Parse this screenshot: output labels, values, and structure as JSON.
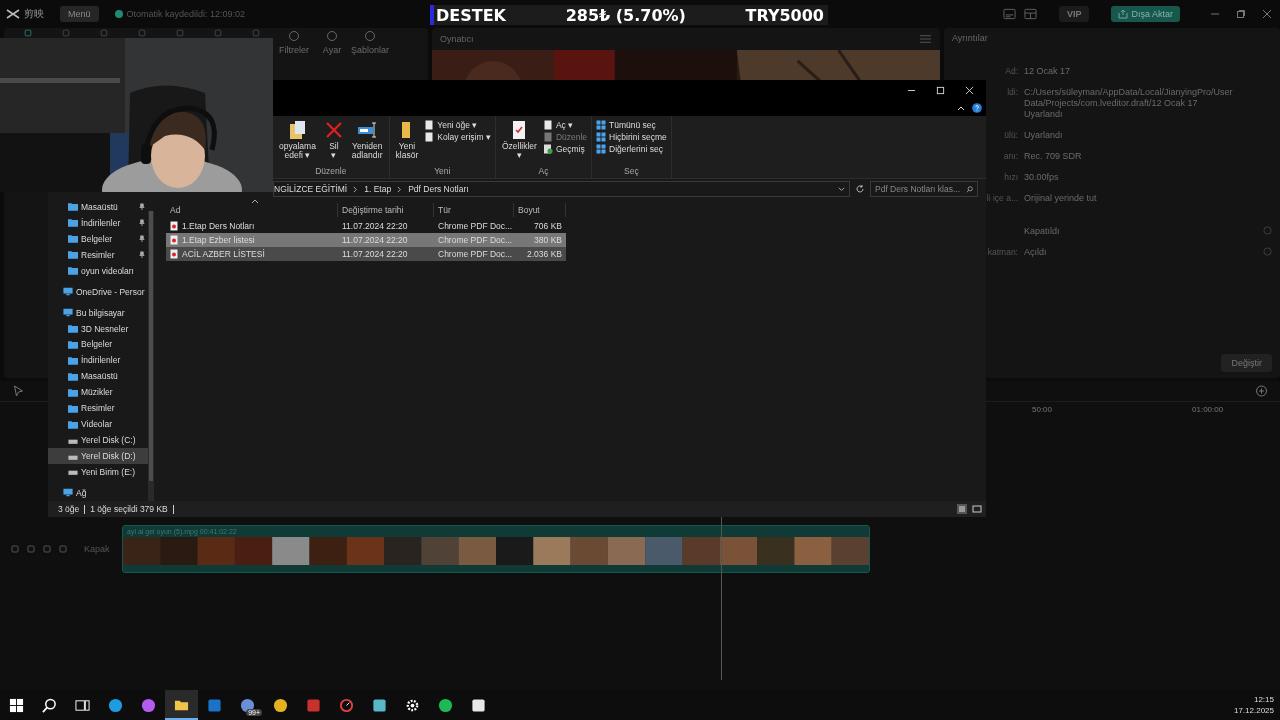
{
  "editor": {
    "app_name": "剪映",
    "menu": "Menü",
    "autosave": "Otomatik kaydedildi: 12:09:02",
    "vip": "VIP",
    "export": "Dışa Aktar",
    "media_tools": [
      "Filtreler",
      "Ayar",
      "Şablonlar"
    ],
    "player_title": "Oynatıcı",
    "details_title": "Ayrıntılar",
    "details": [
      {
        "label": "Ad:",
        "value": "12 Ocak 17"
      },
      {
        "label": "ldi:",
        "value": "C:/Users/süleyman/AppData/Local/JianyingPro/User Data/Projects/com.lveditor.draft/12 Ocak 17"
      },
      {
        "value": "Uyarlandı"
      },
      {
        "label": "ülü:",
        "value": "Uyarlandı"
      },
      {
        "label": "anı:",
        "value": "Rec. 709 SDR"
      },
      {
        "label": "hızı",
        "value": "30.00fps"
      },
      {
        "label": "li içe a...",
        "value": "Orijinal yerinde tut"
      }
    ],
    "settings": [
      {
        "value": "Kapatıldı"
      },
      {
        "label": "katman:",
        "value": "Açıldı"
      }
    ],
    "change_button": "Değiştir",
    "ruler": [
      "50:00",
      "01:00:00"
    ],
    "track_label": "Kapak",
    "clip_title": "ayi al gel  oyun (5).mpg  00:41:02:22"
  },
  "overlay": {
    "segments": [
      "DESTEK",
      "285₺ (5.70%)",
      "TRY5000"
    ]
  },
  "explorer": {
    "ribbon": [
      {
        "name": "Düzenle",
        "items": [
          {
            "kind": "large",
            "lines": [
              "opyalama",
              "edefi ▾"
            ],
            "disabled": false
          },
          {
            "kind": "large",
            "lines": [
              "Sil",
              "▾"
            ],
            "disabled": false
          },
          {
            "kind": "large",
            "lines": [
              "Yeniden",
              "adlandır"
            ],
            "disabled": false
          }
        ]
      },
      {
        "name": "Yeni",
        "items": [
          {
            "kind": "large",
            "lines": [
              "Yeni",
              "klasör"
            ],
            "disabled": false
          },
          {
            "kind": "small",
            "lines": [
              "Yeni öğe ▾"
            ],
            "disabled": false
          },
          {
            "kind": "small",
            "lines": [
              "Kolay erişim ▾"
            ],
            "disabled": false
          }
        ]
      },
      {
        "name": "Aç",
        "items": [
          {
            "kind": "large",
            "lines": [
              "Özellikler",
              "▾"
            ],
            "disabled": false
          },
          {
            "kind": "small",
            "lines": [
              "Aç ▾"
            ],
            "disabled": false
          },
          {
            "kind": "small",
            "lines": [
              "Düzenle"
            ],
            "disabled": true
          },
          {
            "kind": "small",
            "lines": [
              "Geçmiş"
            ],
            "disabled": false
          }
        ]
      },
      {
        "name": "Seç",
        "items": [
          {
            "kind": "small",
            "lines": [
              "Tümünü seç"
            ],
            "disabled": false
          },
          {
            "kind": "small",
            "lines": [
              "Hiçbirini seçme"
            ],
            "disabled": false
          },
          {
            "kind": "small",
            "lines": [
              "Diğerlerini seç"
            ],
            "disabled": false
          }
        ]
      }
    ],
    "breadcrumb": [
      "NGİLİZCE EĞİTİMİ",
      "1. Etap",
      "Pdf Ders Notları"
    ],
    "search_placeholder": "Pdf Ders Notları klas...",
    "nav": [
      {
        "label": "Masaüstü",
        "kind": "folder",
        "pinned": true,
        "selected": false
      },
      {
        "label": "İndirilenler",
        "kind": "folder",
        "pinned": true,
        "selected": false
      },
      {
        "label": "Belgeler",
        "kind": "folder",
        "pinned": true,
        "selected": false
      },
      {
        "label": "Resimler",
        "kind": "folder",
        "pinned": true,
        "selected": false
      },
      {
        "label": "oyun videoları",
        "kind": "folder",
        "pinned": false,
        "selected": false
      },
      {
        "label": "OneDrive - Persor",
        "kind": "location",
        "pinned": false,
        "selected": false
      },
      {
        "label": "Bu bilgisayar",
        "kind": "location",
        "pinned": false,
        "selected": false,
        "children": [
          {
            "label": "3D Nesneler",
            "kind": "folder",
            "pinned": false,
            "selected": false
          },
          {
            "label": "Belgeler",
            "kind": "folder",
            "pinned": false,
            "selected": false
          },
          {
            "label": "İndirilenler",
            "kind": "folder",
            "pinned": false,
            "selected": false
          },
          {
            "label": "Masaüstü",
            "kind": "folder",
            "pinned": false,
            "selected": false
          },
          {
            "label": "Müzikler",
            "kind": "folder",
            "pinned": false,
            "selected": false
          },
          {
            "label": "Resimler",
            "kind": "folder",
            "pinned": false,
            "selected": false
          },
          {
            "label": "Videolar",
            "kind": "folder",
            "pinned": false,
            "selected": false
          },
          {
            "label": "Yerel Disk (C:)",
            "kind": "drive",
            "pinned": false,
            "selected": false
          },
          {
            "label": "Yerel Disk (D:)",
            "kind": "drive",
            "pinned": false,
            "selected": true
          },
          {
            "label": "Yeni Birim (E:)",
            "kind": "drive",
            "pinned": false,
            "selected": false
          }
        ]
      },
      {
        "label": "Ağ",
        "kind": "location",
        "pinned": false,
        "selected": false
      }
    ],
    "columns": [
      "Ad",
      "Değiştirme tarihi",
      "Tür",
      "Boyut"
    ],
    "files": [
      {
        "name": "1.Etap Ders Notları",
        "date": "11.07.2024 22:20",
        "type": "Chrome PDF Doc...",
        "size": "706 KB",
        "selected": false,
        "hover": false
      },
      {
        "name": "1.Etap Ezber listesi",
        "date": "11.07.2024 22:20",
        "type": "Chrome PDF Doc...",
        "size": "380 KB",
        "selected": true,
        "hover": false
      },
      {
        "name": "ACİL AZBER LİSTESİ",
        "date": "11.07.2024 22:20",
        "type": "Chrome PDF Doc...",
        "size": "2.036 KB",
        "selected": false,
        "hover": true
      }
    ],
    "status": [
      "3 öğe",
      "1 öğe seçildi  379 KB"
    ]
  },
  "taskbar": {
    "apps": [
      {
        "active": false
      },
      {
        "active": false
      },
      {
        "active": false
      },
      {
        "active": false
      },
      {
        "active": false
      },
      {
        "active": true
      },
      {
        "active": false
      },
      {
        "active": false,
        "badge": "99+"
      },
      {
        "active": false
      },
      {
        "active": false
      },
      {
        "active": false
      },
      {
        "active": false
      },
      {
        "active": false
      },
      {
        "active": false
      },
      {
        "active": false
      }
    ],
    "time": "12:15",
    "date": "17.12.2025"
  }
}
